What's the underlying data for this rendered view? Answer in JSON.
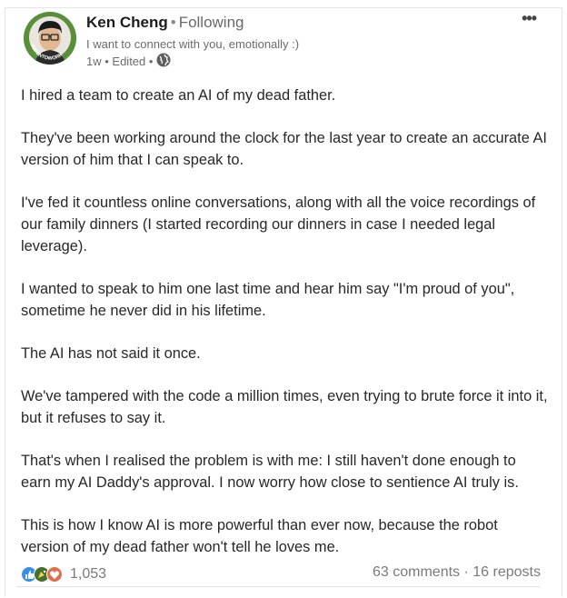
{
  "author": {
    "name": "Ken Cheng",
    "follow_status": "Following",
    "headline": "I want to connect with you, emotionally :)",
    "time": "1w",
    "edited_label": "Edited",
    "avatar_ring_text": "#OPENTOWORK"
  },
  "post": {
    "paragraphs": [
      "I hired a team to create an AI of my dead father.",
      "They've been working around the clock for the last year to create an accurate AI version of him that I can speak to.",
      "I've fed it countless online conversations, along with all the voice recordings of our family dinners (I started recording our dinners in case I needed legal leverage).",
      "I wanted to speak to him one last time and hear him say \"I'm proud of you\", sometime he never did in his lifetime.",
      "The AI has not said it once.",
      "We've tampered with the code a million times, even trying to brute force it into it, but it refuses to say it.",
      "That's when I realised the problem is with me: I still haven't done enough to earn my AI Daddy's approval. I now worry how close to sentience AI truly is.",
      "This is how I know AI is more powerful than ever now, because the robot version of my dead father won't tell he loves me."
    ]
  },
  "footer": {
    "reaction_count": "1,053",
    "comments": "63 comments",
    "separator": "·",
    "reposts": "16 reposts",
    "reaction_icons": [
      "like-icon",
      "celebrate-icon",
      "love-icon"
    ]
  },
  "menu": {
    "more_label": "•••"
  },
  "colors": {
    "like": "#378fe9",
    "celebrate": "#44712e",
    "love": "#df704d",
    "opentowork": "#5a8f3a"
  }
}
